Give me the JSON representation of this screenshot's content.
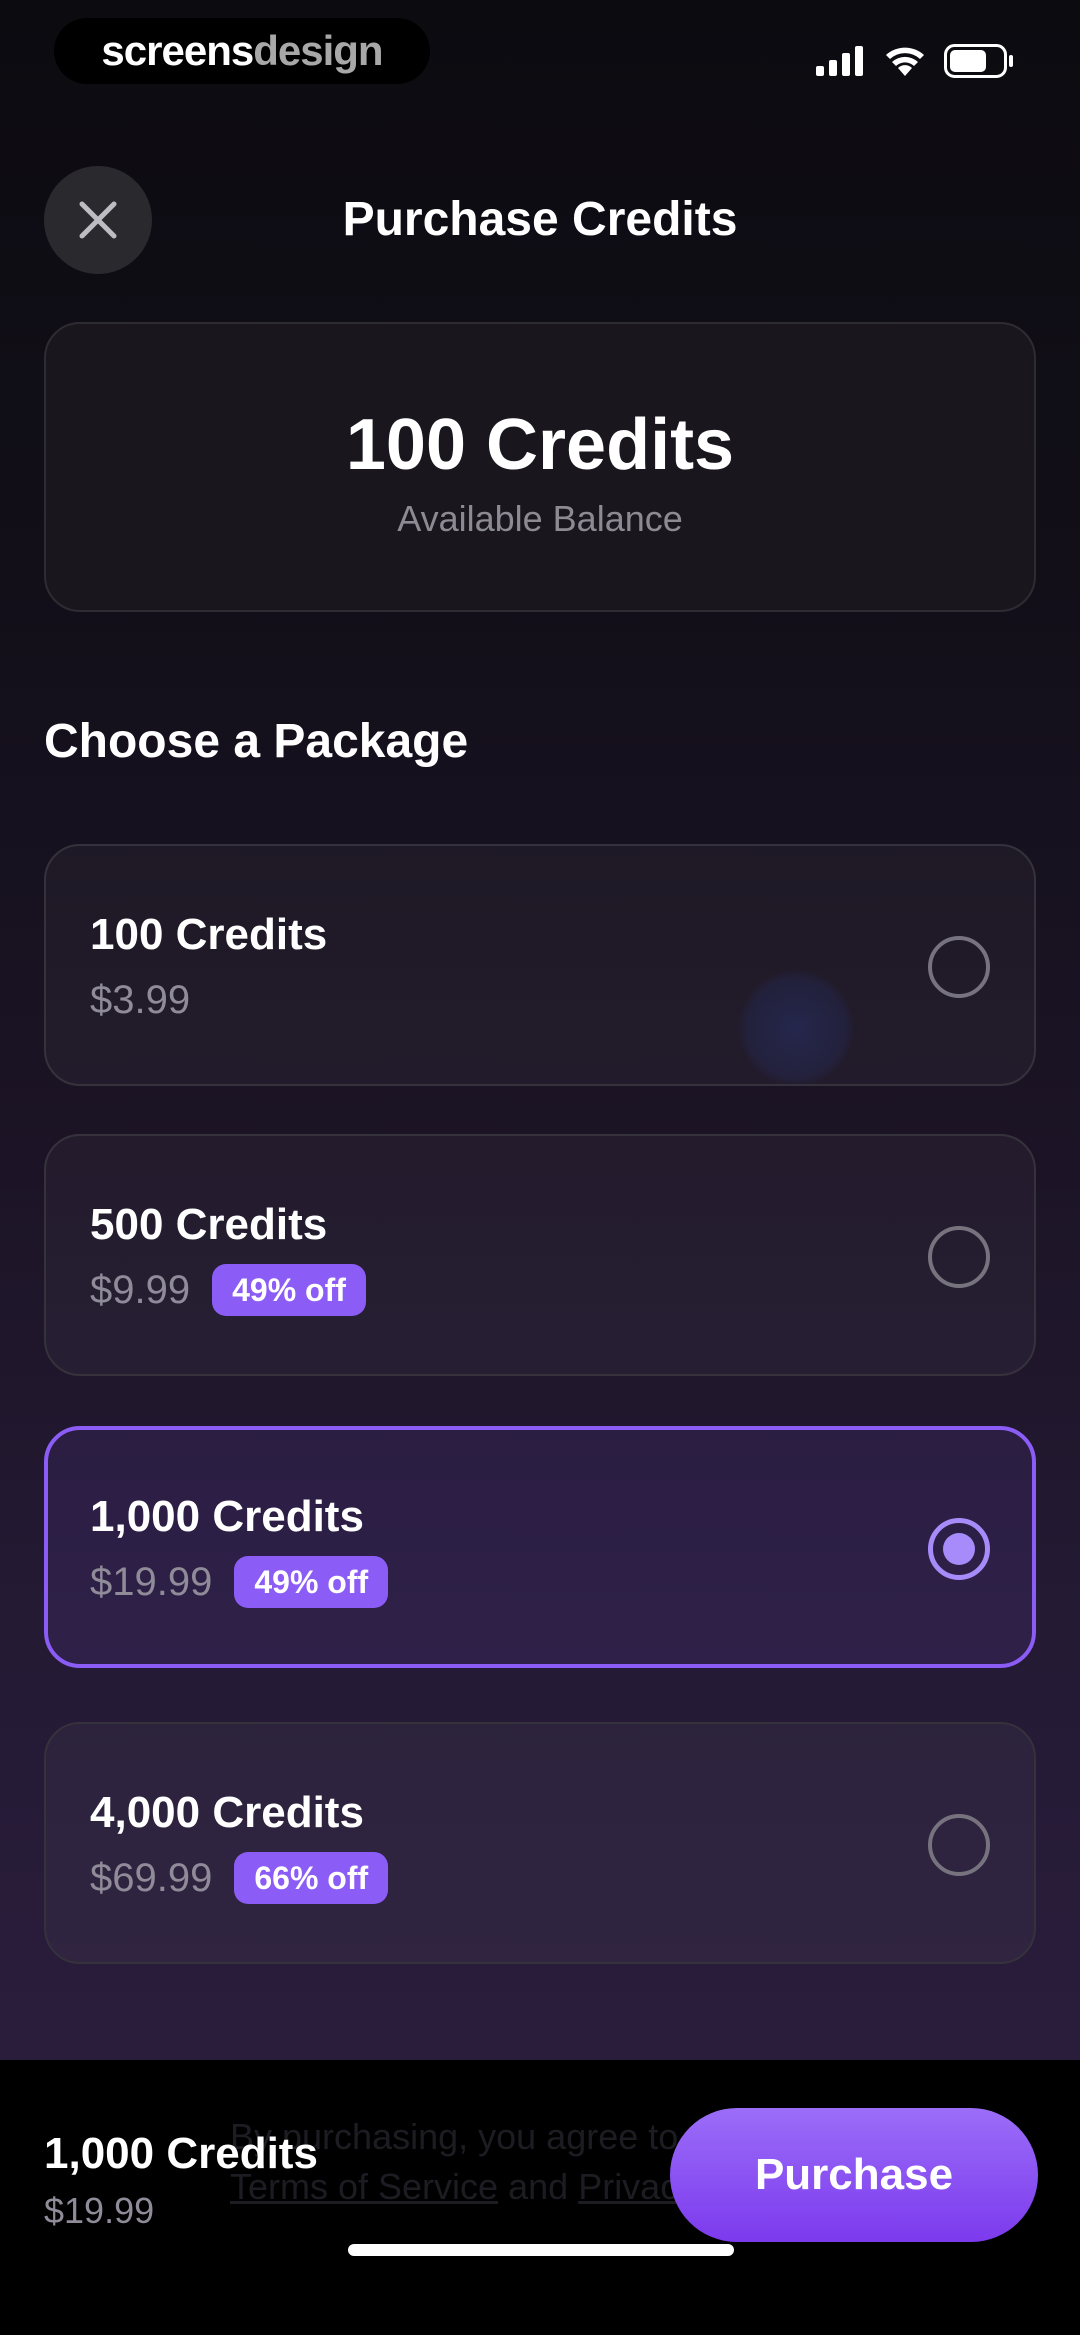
{
  "status_bar": {
    "brand_part1": "screens",
    "brand_part2": "design",
    "icons": [
      "cellular-signal-icon",
      "wifi-icon",
      "battery-icon"
    ]
  },
  "header": {
    "title": "Purchase Credits",
    "close_icon": "close-icon"
  },
  "balance": {
    "amount": "100 Credits",
    "label": "Available Balance"
  },
  "section_title": "Choose a Package",
  "packages": [
    {
      "name": "100 Credits",
      "price": "$3.99",
      "badge": "",
      "selected": false
    },
    {
      "name": "500 Credits",
      "price": "$9.99",
      "badge": "49% off",
      "selected": false
    },
    {
      "name": "1,000 Credits",
      "price": "$19.99",
      "badge": "49% off",
      "selected": true
    },
    {
      "name": "4,000 Credits",
      "price": "$69.99",
      "badge": "66% off",
      "selected": false
    }
  ],
  "footer": {
    "selected_name": "1,000 Credits",
    "selected_price": "$19.99",
    "purchase_label": "Purchase",
    "terms_prefix": "By purchasing, you agree to our",
    "terms_link": "Terms of Service",
    "terms_and": "and",
    "privacy_link": "Privacy Policy"
  },
  "colors": {
    "accent": "#8b5cf6",
    "accent_light": "#a78bfa",
    "muted_text": "#8f8b98",
    "background_top": "#0c0b10",
    "background_bottom": "#2c1f40"
  }
}
